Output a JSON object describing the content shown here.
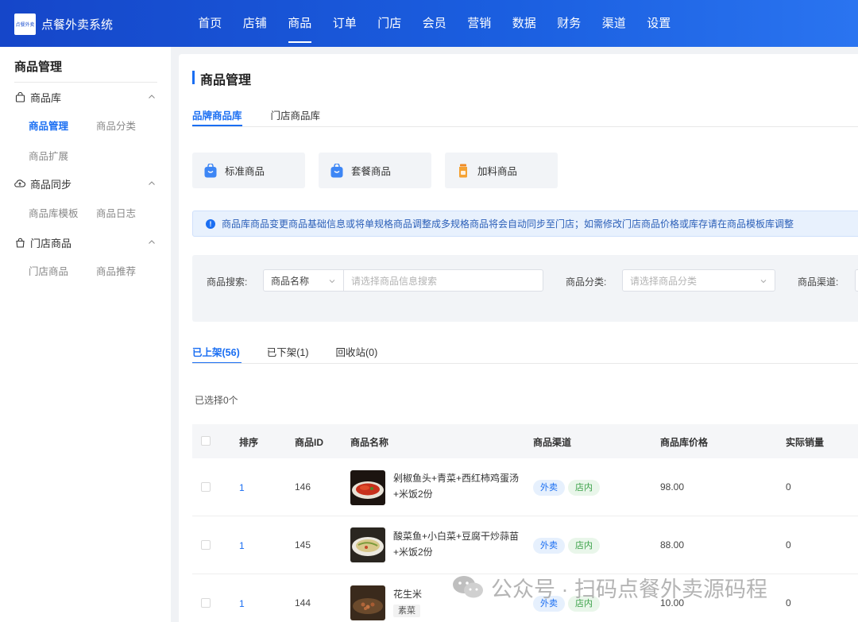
{
  "app": {
    "title": "点餐外卖系统",
    "logo_text": "点餐外卖"
  },
  "topnav": [
    {
      "label": "首页",
      "active": false
    },
    {
      "label": "店铺",
      "active": false
    },
    {
      "label": "商品",
      "active": true
    },
    {
      "label": "订单",
      "active": false
    },
    {
      "label": "门店",
      "active": false
    },
    {
      "label": "会员",
      "active": false
    },
    {
      "label": "营销",
      "active": false
    },
    {
      "label": "数据",
      "active": false
    },
    {
      "label": "财务",
      "active": false
    },
    {
      "label": "渠道",
      "active": false
    },
    {
      "label": "设置",
      "active": false
    }
  ],
  "sidebar": {
    "title": "商品管理",
    "groups": [
      {
        "label": "商品库",
        "icon": "bag-icon",
        "items": [
          "商品管理",
          "商品分类",
          "商品扩展"
        ]
      },
      {
        "label": "商品同步",
        "icon": "cloud-sync-icon",
        "items": [
          "商品库模板",
          "商品日志"
        ]
      },
      {
        "label": "门店商品",
        "icon": "store-bag-icon",
        "items": [
          "门店商品",
          "商品推荐"
        ]
      }
    ],
    "active_item": "商品管理"
  },
  "page": {
    "title": "商品管理",
    "library_tabs": [
      "品牌商品库",
      "门店商品库"
    ],
    "active_library_tab": "品牌商品库",
    "type_cards": [
      {
        "label": "标准商品",
        "icon": "standard-product-icon"
      },
      {
        "label": "套餐商品",
        "icon": "combo-product-icon"
      },
      {
        "label": "加料商品",
        "icon": "addon-product-icon"
      }
    ],
    "notice": "商品库商品变更商品基础信息或将单规格商品调整成多规格商品将会自动同步至门店；如需修改门店商品价格或库存请在商品模板库调整",
    "filter": {
      "search_label": "商品搜索:",
      "search_type": "商品名称",
      "search_placeholder": "请选择商品信息搜索",
      "category_label": "商品分类:",
      "category_placeholder": "请选择商品分类",
      "channel_label": "商品渠道:"
    },
    "status_tabs": [
      "已上架(56)",
      "已下架(1)",
      "回收站(0)"
    ],
    "active_status_tab": "已上架(56)",
    "selected_count": "已选择0个",
    "table": {
      "columns": [
        "排序",
        "商品ID",
        "商品名称",
        "商品渠道",
        "商品库价格",
        "实际销量"
      ],
      "rows": [
        {
          "sort": "1",
          "id": "146",
          "name": "剁椒鱼头+青菜+西红柿鸡蛋汤+米饭2份",
          "tag": "",
          "channels": [
            "外卖",
            "店内"
          ],
          "price": "98.00",
          "sales": "0"
        },
        {
          "sort": "1",
          "id": "145",
          "name": "酸菜鱼+小白菜+豆腐干炒蒜苗+米饭2份",
          "tag": "",
          "channels": [
            "外卖",
            "店内"
          ],
          "price": "88.00",
          "sales": "0"
        },
        {
          "sort": "1",
          "id": "144",
          "name": "花生米",
          "tag": "素菜",
          "channels": [
            "外卖",
            "店内"
          ],
          "price": "10.00",
          "sales": "0"
        }
      ]
    }
  },
  "watermark": "公众号 · 扫码点餐外卖源码程",
  "colors": {
    "primary": "#1a6ef2",
    "header": "#1b5fe0",
    "green": "#3aa148"
  }
}
